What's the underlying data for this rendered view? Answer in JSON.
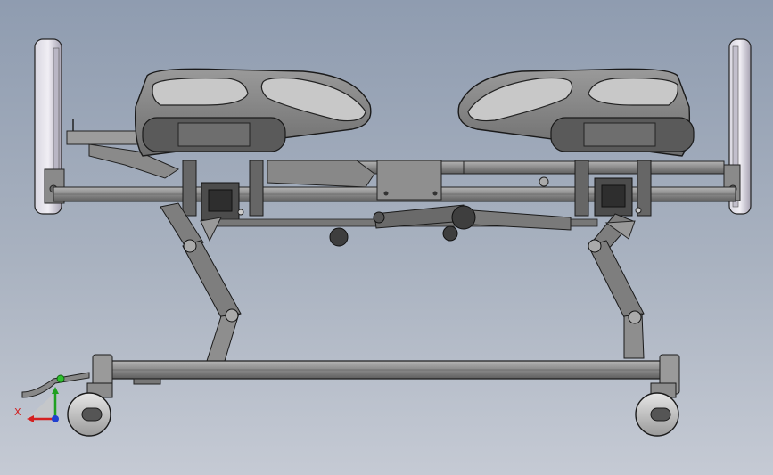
{
  "viewport": {
    "background_top": "#8f9cb0",
    "background_bottom": "#c5cad4"
  },
  "model": {
    "subject": "hospital-bed-side-view",
    "part_fill": "#8a8a8a",
    "part_dark": "#3a3a3a",
    "edge_color": "#1a1a1a",
    "headboard_fill": "#c9c6d2"
  },
  "triad": {
    "x_label": "X",
    "x_color": "#d42020",
    "y_color": "#20a020",
    "z_color": "#2040d0"
  }
}
